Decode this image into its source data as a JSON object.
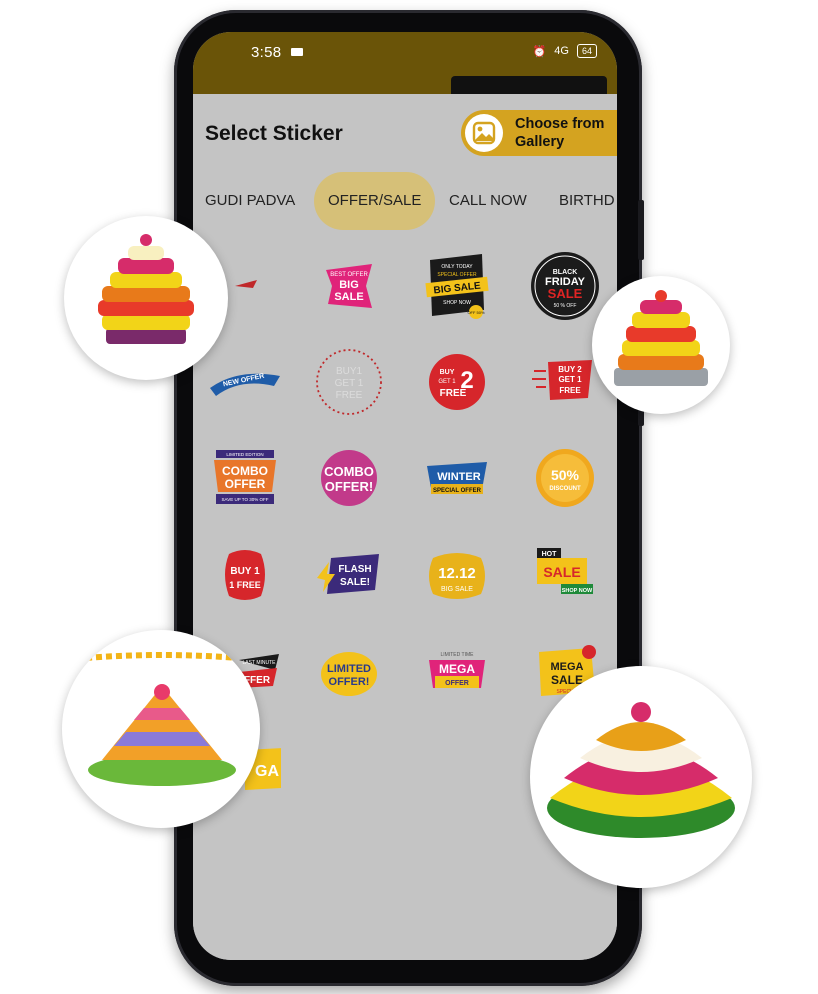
{
  "status": {
    "time": "3:58",
    "battery": "64",
    "network": "4G"
  },
  "sheet": {
    "title": "Select Sticker",
    "gallery_button": "Choose from Gallery"
  },
  "tabs": [
    {
      "label": "GUDI PADVA",
      "active": false
    },
    {
      "label": "OFFER/SALE",
      "active": true
    },
    {
      "label": "CALL NOW",
      "active": false
    },
    {
      "label": "BIRTHD",
      "active": false
    }
  ],
  "stickers": [
    {
      "name": "sale-arrow-sticker",
      "lines": []
    },
    {
      "name": "big-sale-sticker",
      "lines": [
        "BEST OFFER",
        "BIG",
        "SALE"
      ]
    },
    {
      "name": "only-today-big-sale-sticker",
      "lines": [
        "ONLY TODAY",
        "SPECIAL OFFER",
        "BIG SALE",
        "SHOP NOW",
        "OFF 50%"
      ]
    },
    {
      "name": "black-friday-sticker",
      "lines": [
        "BLACK",
        "FRIDAY",
        "SALE",
        "50 % OFF"
      ]
    },
    {
      "name": "new-offer-sticker",
      "lines": [
        "NEW OFFER"
      ]
    },
    {
      "name": "buy1-get1-free-outline-sticker",
      "lines": [
        "BUY1",
        "GET 1",
        "FREE"
      ]
    },
    {
      "name": "buy1-get2-free-sticker",
      "lines": [
        "BUY",
        "GET 1",
        "2",
        "FREE"
      ]
    },
    {
      "name": "buy2-get1-free-sticker",
      "lines": [
        "BUY 2",
        "GET 1",
        "FREE"
      ]
    },
    {
      "name": "combo-offer-sticker",
      "lines": [
        "LIMITED EDITION",
        "COMBO",
        "OFFER",
        "SAVE UP TO 30% OFF"
      ]
    },
    {
      "name": "combo-offer-bubble-sticker",
      "lines": [
        "COMBO",
        "OFFER!"
      ]
    },
    {
      "name": "winter-special-sticker",
      "lines": [
        "WINTER",
        "SPECIAL OFFER"
      ]
    },
    {
      "name": "fifty-percent-discount-sticker",
      "lines": [
        "50%",
        "DISCOUNT"
      ]
    },
    {
      "name": "buy1-1free-sticker",
      "lines": [
        "BUY 1",
        "1 FREE"
      ]
    },
    {
      "name": "flash-sale-sticker",
      "lines": [
        "FLASH",
        "SALE!"
      ]
    },
    {
      "name": "twelve-twelve-sale-sticker",
      "lines": [
        "12.12",
        "BIG SALE"
      ]
    },
    {
      "name": "hot-sale-sticker",
      "lines": [
        "HOT",
        "SALE",
        "SHOP NOW"
      ]
    },
    {
      "name": "last-minute-offer-sticker",
      "lines": [
        "LAST MINUTE",
        "FFER"
      ]
    },
    {
      "name": "limited-offer-sticker",
      "lines": [
        "LIMITED",
        "OFFER!"
      ]
    },
    {
      "name": "mega-offer-sticker",
      "lines": [
        "LIMITED TIME",
        "MEGA",
        "OFFER"
      ]
    },
    {
      "name": "mega-sale-sticker",
      "lines": [
        "MEGA",
        "SALE",
        "SPECIAL"
      ]
    },
    {
      "name": "mega-partial-sticker",
      "lines": [
        "GA"
      ]
    }
  ],
  "colors": {
    "accent": "#d4a320",
    "tab_active": "#d6c078",
    "overlay": "#c4c4c4",
    "appbar": "#6a5408"
  }
}
